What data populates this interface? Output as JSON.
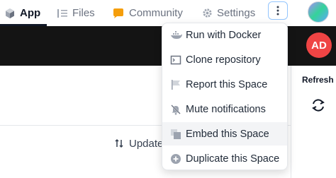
{
  "tabs": [
    {
      "label": "App",
      "icon": "app-cube-icon",
      "active": true
    },
    {
      "label": "Files",
      "icon": "files-icon",
      "active": false
    },
    {
      "label": "Community",
      "icon": "community-icon",
      "active": false
    },
    {
      "label": "Settings",
      "icon": "gear-icon",
      "active": false
    }
  ],
  "header": {
    "more_icon": "vertical-dots-icon",
    "user_avatar": "avatar"
  },
  "space_bar": {
    "avatar_initials": "AD",
    "avatar_color": "#ef4444"
  },
  "side_panel": {
    "refresh_label": "Refresh",
    "refresh_icon": "refresh-icon"
  },
  "content": {
    "update_label": "Update",
    "update_icon": "sort-arrows-icon"
  },
  "menu": {
    "items": [
      {
        "label": "Run with Docker",
        "icon": "docker-icon"
      },
      {
        "label": "Clone repository",
        "icon": "terminal-icon"
      },
      {
        "label": "Report this Space",
        "icon": "flag-icon"
      },
      {
        "label": "Mute notifications",
        "icon": "muted-bell-icon"
      },
      {
        "label": "Embed this Space",
        "icon": "embed-icon",
        "hovered": true
      },
      {
        "label": "Duplicate this Space",
        "icon": "duplicate-icon"
      }
    ]
  },
  "colors": {
    "accent_border": "#93c5fd",
    "dark_bar": "#141414",
    "community_icon": "#f59e0b"
  }
}
